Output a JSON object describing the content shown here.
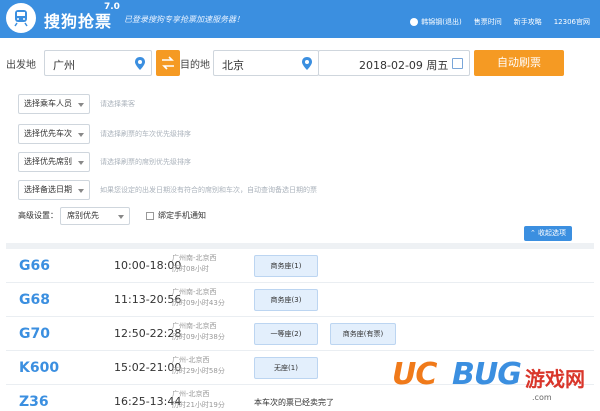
{
  "header": {
    "app_name": "搜狗抢票",
    "version": "7.0",
    "slogan": "已登录搜狗专享抢票加速服务器！",
    "user": "韩锦钢(退出)",
    "links": [
      "售票时间",
      "新手攻略",
      "12306官网"
    ]
  },
  "search": {
    "from_label": "出发地",
    "from_value": "广州",
    "to_label": "目的地",
    "to_value": "北京",
    "date_value": "2018-02-09 周五",
    "auto_button": "自动刷票",
    "selects": [
      {
        "label": "选择乘车人员",
        "hint": "请选择乘客"
      },
      {
        "label": "选择优先车次",
        "hint": "请选择刷票的车次优先级排序"
      },
      {
        "label": "选择优先席别",
        "hint": "请选择刷票的席别优先级排序"
      },
      {
        "label": "选择备选日期",
        "hint": "如果您设定的出发日期没有符合的席别和车次，自动查询备选日期的票"
      }
    ],
    "advanced_label": "高级设置：",
    "advanced_value": "席别优先",
    "phone_notify": "绑定手机通知",
    "collapse_button": "收起选项"
  },
  "trains": [
    {
      "no": "G66",
      "time": "10:00-18:00",
      "route": "广州南-北京西",
      "duration": "历时08小时",
      "seats": [
        "商务座(1)"
      ],
      "sold": ""
    },
    {
      "no": "G68",
      "time": "11:13-20:56",
      "route": "广州南-北京西",
      "duration": "历时09小时43分",
      "seats": [
        "商务座(3)"
      ],
      "sold": ""
    },
    {
      "no": "G70",
      "time": "12:50-22:28",
      "route": "广州南-北京西",
      "duration": "历时09小时38分",
      "seats": [
        "一等座(2)",
        "商务座(有票)"
      ],
      "sold": ""
    },
    {
      "no": "K600",
      "time": "15:02-21:00",
      "route": "广州-北京西",
      "duration": "历时29小时58分",
      "seats": [
        "无座(1)"
      ],
      "sold": ""
    },
    {
      "no": "Z36",
      "time": "16:25-13:44",
      "route": "广州-北京西",
      "duration": "历时21小时19分",
      "seats": [],
      "sold": "本车次的票已经卖完了"
    }
  ],
  "watermark": {
    "uc": "UC",
    "bug": "BUG",
    "cn": "游戏网",
    "url": ".com"
  },
  "colors": {
    "primary": "#3b8fe0",
    "accent": "#f59a23"
  }
}
